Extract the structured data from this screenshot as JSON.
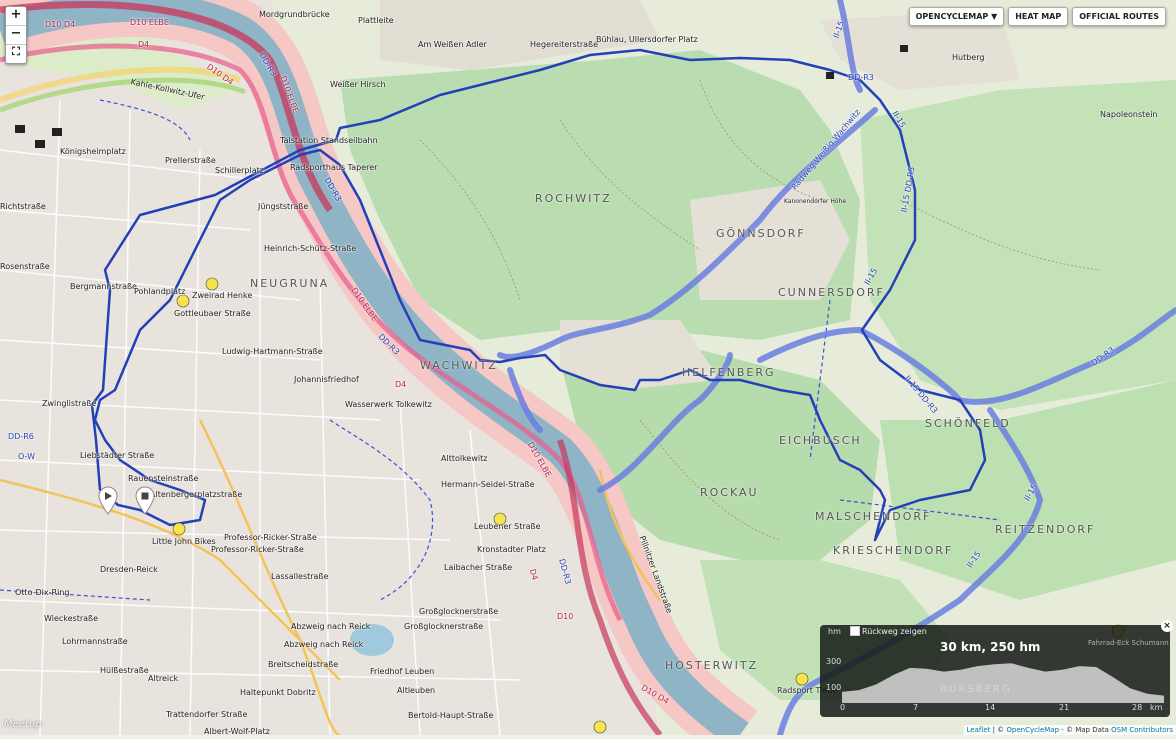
{
  "zoom": {
    "in": "+",
    "out": "−",
    "fullscreen": "⛶"
  },
  "buttons": {
    "opencyclemap": "OPENCYCLEMAP ▼",
    "heatmap": "HEAT MAP",
    "official_routes": "OFFICIAL ROUTES"
  },
  "elevation": {
    "unit": "hm",
    "back_label": "Rückweg zeigen",
    "summary": "30 km, 250 hm",
    "y_ticks": [
      "300",
      "100"
    ],
    "x_ticks": [
      "0",
      "7",
      "14",
      "21",
      "28"
    ],
    "x_unit": "km",
    "close": "×",
    "overlay_label": "BORSBERG",
    "overlay_label2": "Fahrrad-Eck Schumann",
    "profile_hm": [
      120,
      130,
      160,
      210,
      250,
      245,
      230,
      240,
      260,
      270,
      275,
      250,
      230,
      240,
      260,
      255,
      200,
      140,
      110,
      100
    ]
  },
  "attribution": {
    "leaflet": "Leaflet",
    "sep1": " | © ",
    "ocm": "OpenCycleMap",
    "mid": " - © Map Data ",
    "osm": "OSM Contributors"
  },
  "watermark": "Meetup",
  "districts": [
    "ROCHWITZ",
    "GÖNNSDORF",
    "CUNNERSDORF",
    "NEUGRUNA",
    "WACHWITZ",
    "HELFENBERG",
    "EICHBUSCH",
    "SCHÖNFELD",
    "ROCKAU",
    "MALSCHENDORF",
    "REITZENDORF",
    "KRIESCHENDORF",
    "HOSTERWITZ"
  ],
  "labels": [
    "Mordgrundbrücke",
    "Plattleite",
    "Am Weißen Adler",
    "Hegereiterstraße",
    "Bühlau, Ullersdorfer Platz",
    "Weißer Hirsch",
    "Talstation Standseilbahn",
    "Radsporthaus Taperer",
    "Königsheimplatz",
    "Prellerstraße",
    "Schillerplatz",
    "Jüngststraße",
    "Heinrich-Schütz-Straße",
    "Bergmannstraße",
    "Pohlandplatz",
    "Zweirad Henke",
    "Gottleubaer Straße",
    "Ludwig-Hartmann-Straße",
    "Johannisfriedhof",
    "Wasserwerk Tolkewitz",
    "Zwinglistraße",
    "Liebstädter Straße",
    "Rauensteinstraße",
    "Altenbergerplatzstraße",
    "Little John Bikes",
    "Professor-Ricker-Straße",
    "Professor-Ricker-Straße",
    "Dresden-Reick",
    "Lassallestraße",
    "Otto-Dix-Ring",
    "Wieckestraße",
    "Lohrmannstraße",
    "Abzweig nach Reick",
    "Abzweig nach Reick",
    "Breitscheidstraße",
    "Hülßestraße",
    "Altreick",
    "Haltepunkt Dobritz",
    "Trattendorfer Straße",
    "Albert-Wolf-Platz",
    "Friedhof Leuben",
    "Altleuben",
    "Bertold-Haupt-Straße",
    "Alttolkewitz",
    "Hermann-Seidel-Straße",
    "Leubener Straße",
    "Kronstadter Platz",
    "Laibacher Straße",
    "Großglocknerstraße",
    "Großglocknerstraße",
    "Radsport Tiede",
    "Napoleonstein",
    "Hutberg",
    "Kanonendorfer Höhe",
    "Kahle-Kollwitz-Ufer",
    "Rosenstraße",
    "Richtstraße"
  ],
  "route_labels": [
    "D10 D4",
    "D10 ELBE",
    "D4",
    "D10 ELBE",
    "DD-R3",
    "DD-R3",
    "D10 D4",
    "D10 ELBE",
    "DD-R3",
    "D4",
    "DD-R3",
    "II-15",
    "II-15 DD-R3",
    "II-15",
    "II-15",
    "II-15 DD-R3",
    "DD-R3",
    "II-15",
    "II-15",
    "DD-R6",
    "O-W",
    "D10 ELBE",
    "DD-R3",
    "D10",
    "D4",
    "D10 D4",
    "Radweg Weißig Wachwitz",
    "Pillnitzer Landstraße"
  ],
  "colors": {
    "track": "#2440b8",
    "official_route": "#6a7fe0",
    "elbe": "#8fb4c6",
    "forest": "#a8d4a0",
    "road_main": "#e85b8a"
  }
}
